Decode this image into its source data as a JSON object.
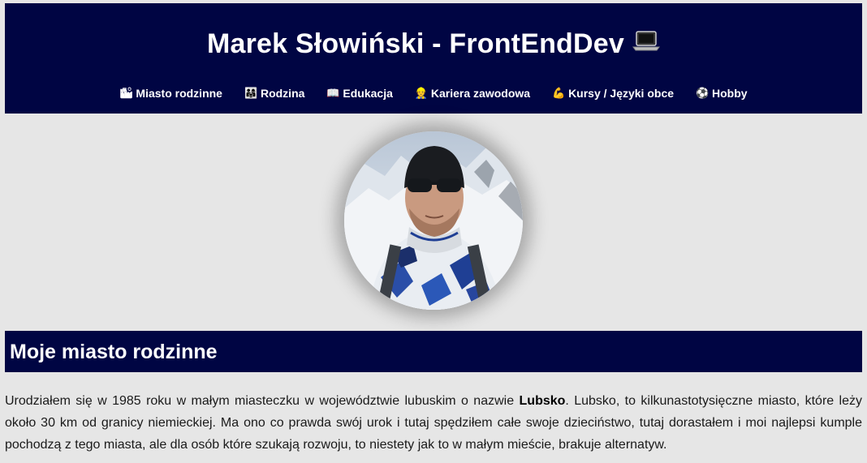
{
  "header": {
    "title": "Marek Słowiński - FrontEndDev",
    "title_icon": "laptop-icon"
  },
  "nav": {
    "items": [
      {
        "label": "Miasto rodzinne",
        "icon": "city-icon",
        "glyph": "🏙"
      },
      {
        "label": "Rodzina",
        "icon": "family-icon",
        "glyph": "👨‍👩‍👧"
      },
      {
        "label": "Edukacja",
        "icon": "book-icon",
        "glyph": "📖"
      },
      {
        "label": "Kariera zawodowa",
        "icon": "worker-icon",
        "glyph": "👷"
      },
      {
        "label": "Kursy / Języki obce",
        "icon": "flexed-biceps-icon",
        "glyph": "💪"
      },
      {
        "label": "Hobby",
        "icon": "soccer-ball-icon",
        "glyph": "⚽"
      }
    ]
  },
  "profile": {
    "photo": "profile-photo"
  },
  "section": {
    "title": "Moje miasto rodzinne",
    "paragraph_before": "Urodziałem się w 1985 roku w małym miasteczku w województwie lubuskim o nazwie ",
    "paragraph_bold": "Lubsko",
    "paragraph_after": ". Lubsko, to kilkunastotysięczne miasto, które leży około 30 km od granicy niemieckiej. Ma ono co prawda swój urok i tutaj spędziłem całe swoje dzieciństwo, tutaj dorastałem i moi najlepsi kumple pochodzą z tego miasta, ale dla osób które szukają rozwoju, to niestety jak to w małym mieście, brakuje alternatyw."
  },
  "colors": {
    "header_bg": "#000543",
    "page_bg": "#e6e6e6",
    "text": "#1a1a1a"
  }
}
